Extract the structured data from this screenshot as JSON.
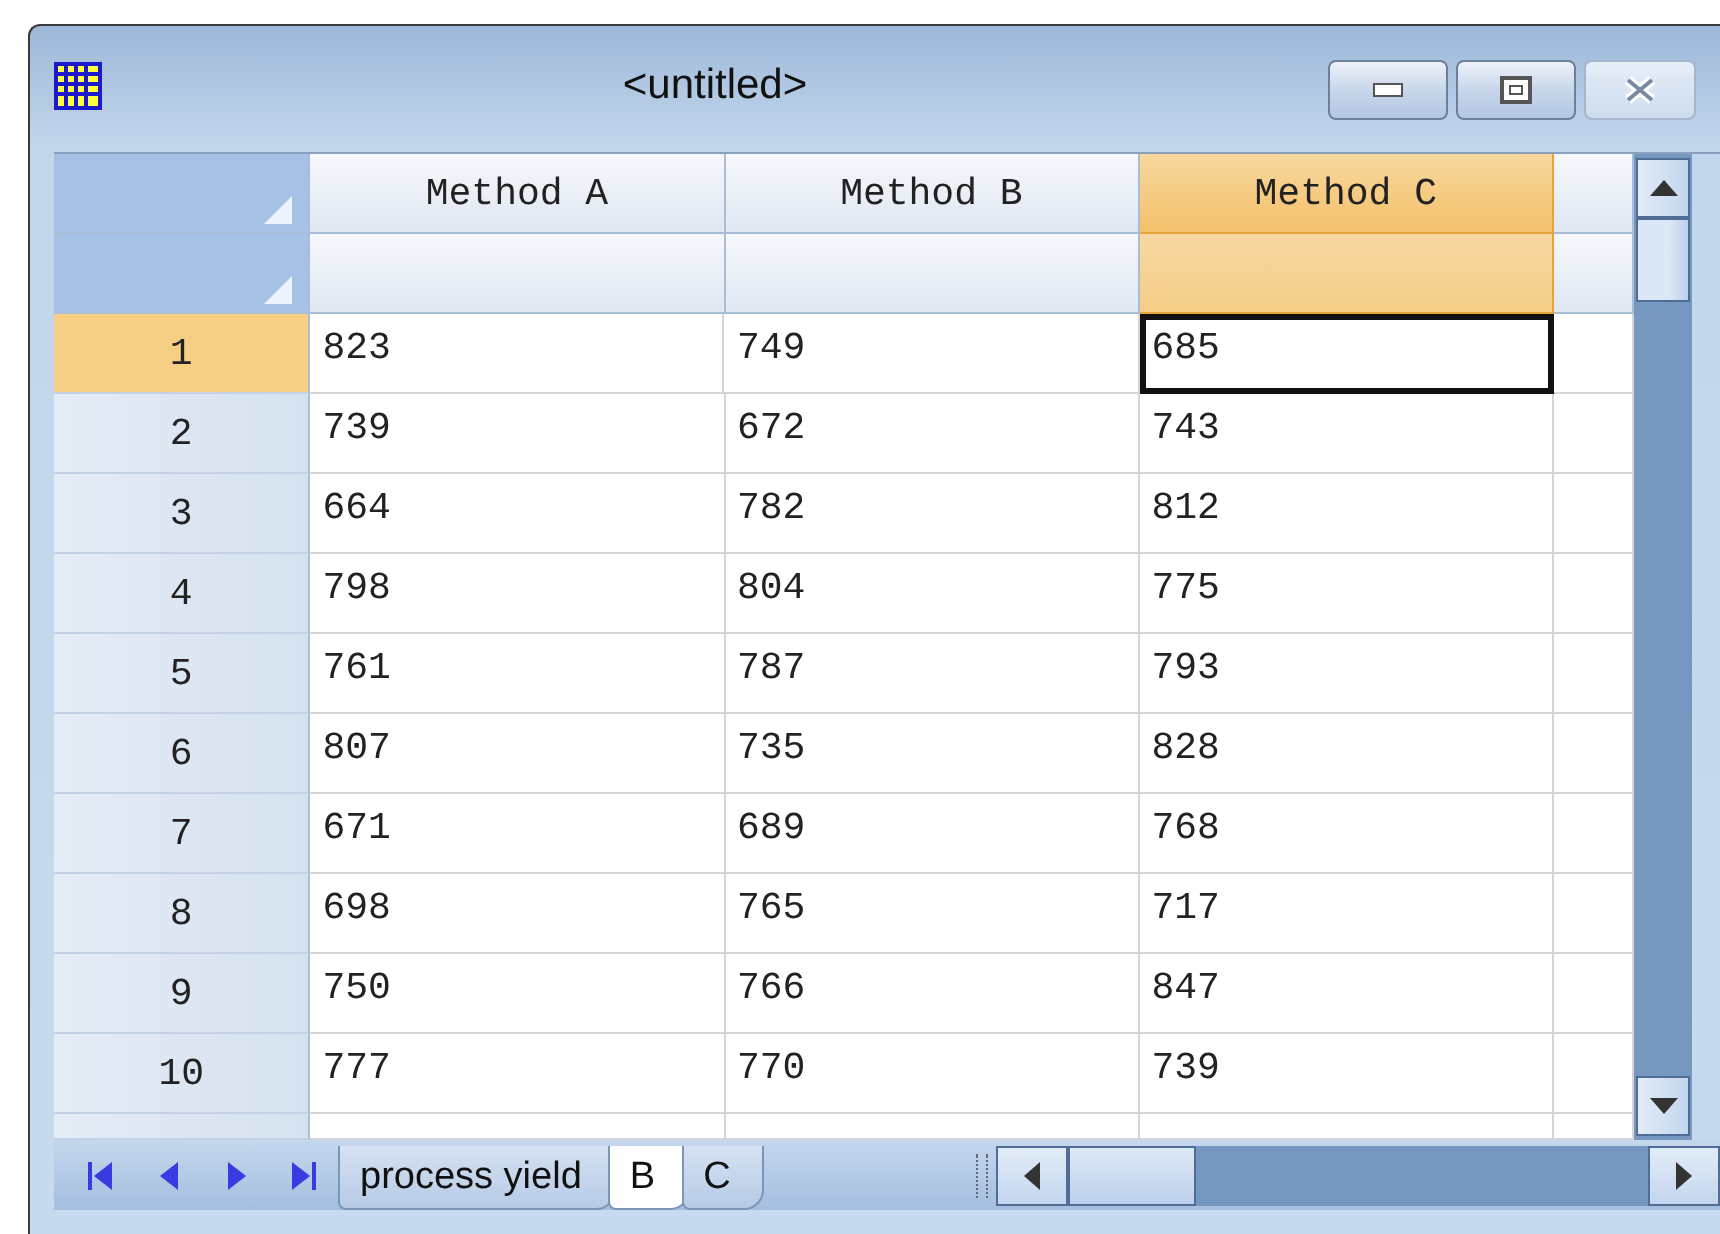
{
  "window": {
    "title": "<untitled>"
  },
  "columns": [
    {
      "label": "Method A",
      "selected": false
    },
    {
      "label": "Method B",
      "selected": false
    },
    {
      "label": "Method C",
      "selected": true
    }
  ],
  "rows": [
    {
      "number": "1",
      "selected": true,
      "cells": [
        {
          "value": "823",
          "active": false
        },
        {
          "value": "749",
          "active": false
        },
        {
          "value": "685",
          "active": true
        }
      ]
    },
    {
      "number": "2",
      "selected": false,
      "cells": [
        {
          "value": "739",
          "active": false
        },
        {
          "value": "672",
          "active": false
        },
        {
          "value": "743",
          "active": false
        }
      ]
    },
    {
      "number": "3",
      "selected": false,
      "cells": [
        {
          "value": "664",
          "active": false
        },
        {
          "value": "782",
          "active": false
        },
        {
          "value": "812",
          "active": false
        }
      ]
    },
    {
      "number": "4",
      "selected": false,
      "cells": [
        {
          "value": "798",
          "active": false
        },
        {
          "value": "804",
          "active": false
        },
        {
          "value": "775",
          "active": false
        }
      ]
    },
    {
      "number": "5",
      "selected": false,
      "cells": [
        {
          "value": "761",
          "active": false
        },
        {
          "value": "787",
          "active": false
        },
        {
          "value": "793",
          "active": false
        }
      ]
    },
    {
      "number": "6",
      "selected": false,
      "cells": [
        {
          "value": "807",
          "active": false
        },
        {
          "value": "735",
          "active": false
        },
        {
          "value": "828",
          "active": false
        }
      ]
    },
    {
      "number": "7",
      "selected": false,
      "cells": [
        {
          "value": "671",
          "active": false
        },
        {
          "value": "689",
          "active": false
        },
        {
          "value": "768",
          "active": false
        }
      ]
    },
    {
      "number": "8",
      "selected": false,
      "cells": [
        {
          "value": "698",
          "active": false
        },
        {
          "value": "765",
          "active": false
        },
        {
          "value": "717",
          "active": false
        }
      ]
    },
    {
      "number": "9",
      "selected": false,
      "cells": [
        {
          "value": "750",
          "active": false
        },
        {
          "value": "766",
          "active": false
        },
        {
          "value": "847",
          "active": false
        }
      ]
    },
    {
      "number": "10",
      "selected": false,
      "cells": [
        {
          "value": "777",
          "active": false
        },
        {
          "value": "770",
          "active": false
        },
        {
          "value": "739",
          "active": false
        }
      ]
    }
  ],
  "sheet_tabs": [
    {
      "label": "process yield",
      "selected": false
    },
    {
      "label": "B",
      "selected": true
    },
    {
      "label": "C",
      "selected": false
    }
  ]
}
